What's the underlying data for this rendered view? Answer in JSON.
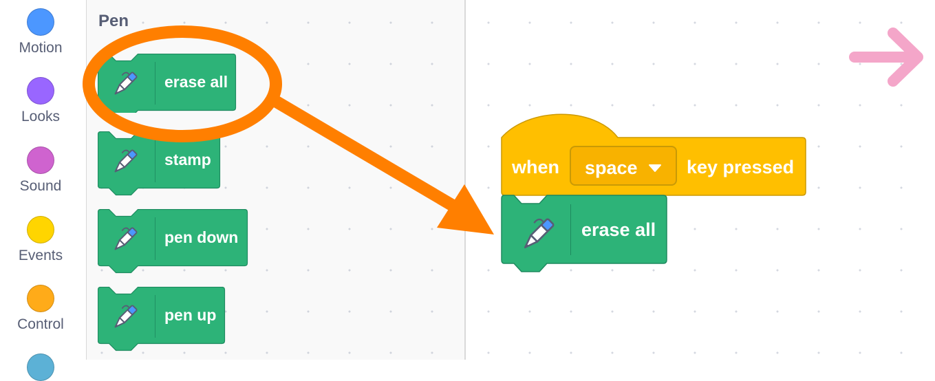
{
  "categories": [
    {
      "label": "Motion",
      "color": "#4c97ff"
    },
    {
      "label": "Looks",
      "color": "#9966ff"
    },
    {
      "label": "Sound",
      "color": "#cf63cf"
    },
    {
      "label": "Events",
      "color": "#ffd500"
    },
    {
      "label": "Control",
      "color": "#ffab19"
    }
  ],
  "palette": {
    "title": "Pen",
    "blocks": [
      {
        "label": "erase all"
      },
      {
        "label": "stamp"
      },
      {
        "label": "pen down"
      },
      {
        "label": "pen up"
      }
    ]
  },
  "workspace": {
    "hat": {
      "when": "when",
      "key": "space",
      "key_pressed": "key pressed"
    },
    "stacked_block": {
      "label": "erase all"
    }
  },
  "colors": {
    "pen_block": "#2db378",
    "pen_border": "#1e8a5f",
    "events_block": "#ffbf00",
    "annotation": "#ff7f00",
    "next_arrow": "#f4a6c9"
  },
  "icons": {
    "pen": "pen-icon",
    "next": "next-arrow-icon"
  }
}
